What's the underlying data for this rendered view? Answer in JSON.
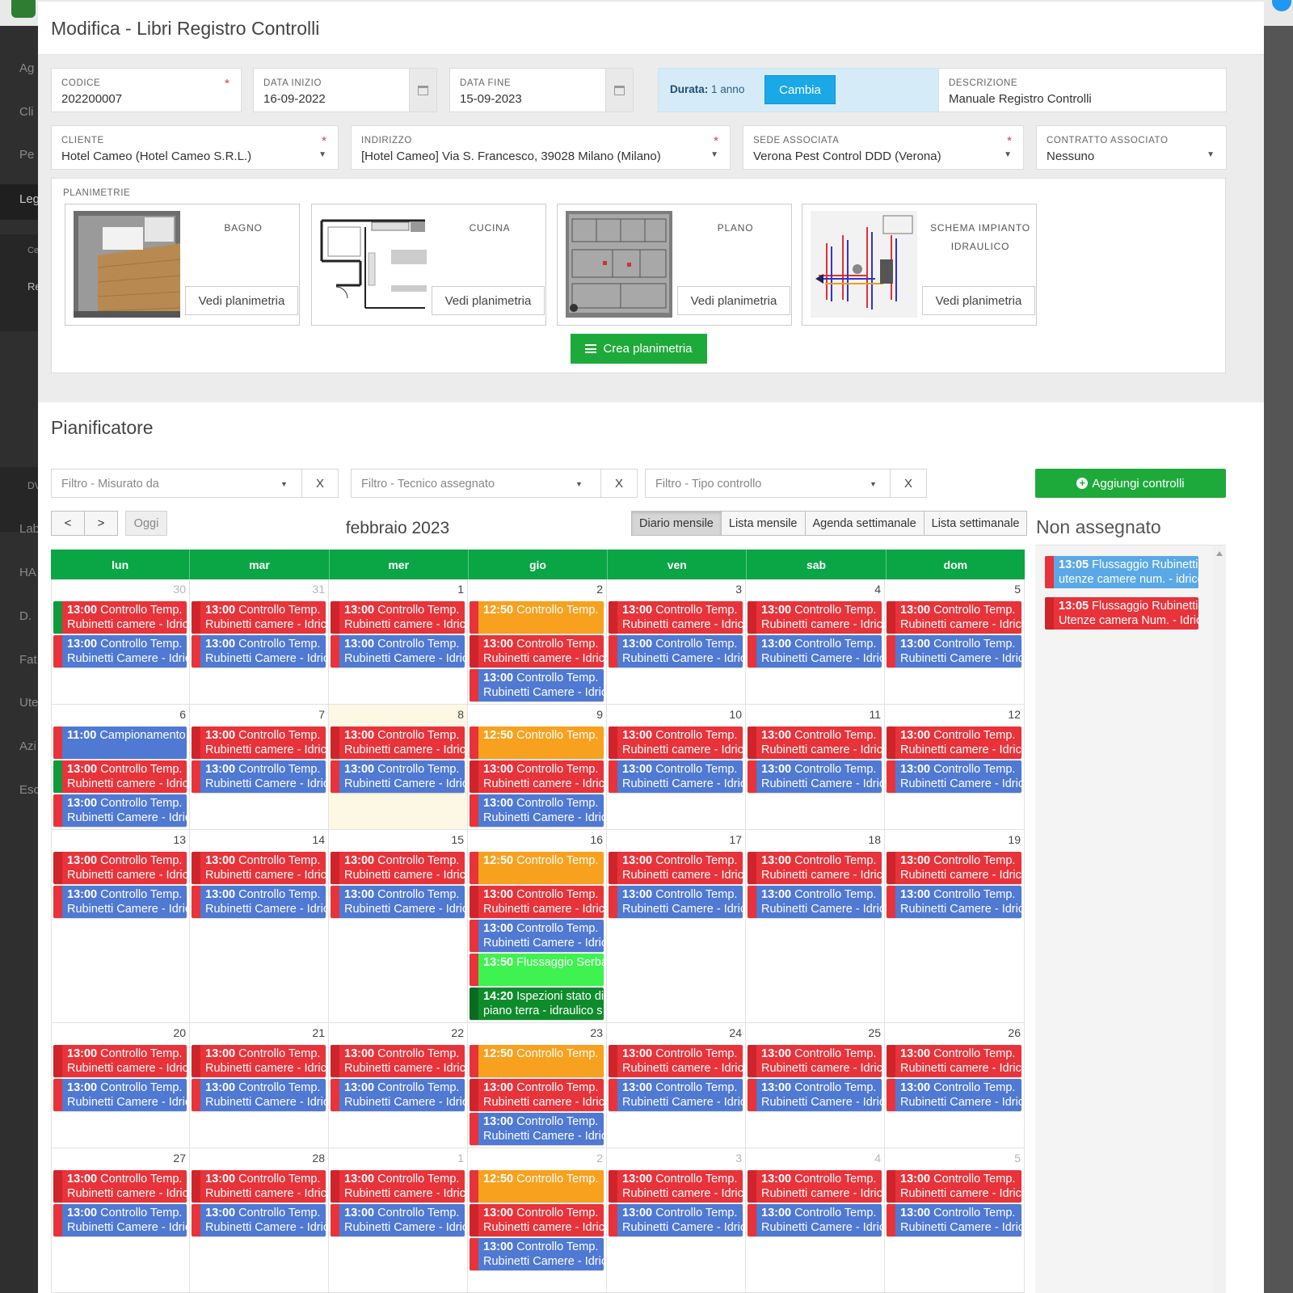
{
  "background": {
    "sidebar_items": [
      "Ag",
      "Cli",
      "Pe",
      "Leg",
      "Ce",
      "Re",
      "DV",
      "Lab",
      "HA",
      "D.",
      "Fat",
      "Ute",
      "Azi",
      "Esc"
    ]
  },
  "modal": {
    "title": "Modifica - Libri Registro Controlli",
    "fields": {
      "codice": {
        "label": "CODICE",
        "value": "202200007",
        "required": "*"
      },
      "data_inizio": {
        "label": "DATA INIZIO",
        "value": "16-09-2022"
      },
      "data_fine": {
        "label": "DATA FINE",
        "value": "15-09-2023"
      },
      "durata": {
        "label": "Durata:",
        "value": "1 anno",
        "button": "Cambia"
      },
      "descrizione": {
        "label": "DESCRIZIONE",
        "value": "Manuale Registro Controlli"
      },
      "cliente": {
        "label": "CLIENTE",
        "value": "Hotel Cameo (Hotel Cameo S.R.L.)",
        "required": "*"
      },
      "indirizzo": {
        "label": "INDIRIZZO",
        "value": "[Hotel Cameo] Via S. Francesco, 39028 Milano (Milano)",
        "required": "*"
      },
      "sede": {
        "label": "SEDE ASSOCIATA",
        "value": "Verona Pest Control DDD (Verona)",
        "required": "*"
      },
      "contratto": {
        "label": "CONTRATTO ASSOCIATO",
        "value": "Nessuno"
      }
    },
    "planimetrie": {
      "label": "PLANIMETRIE",
      "cards": [
        {
          "name": "BAGNO",
          "button": "Vedi planimetria"
        },
        {
          "name": "CUCINA",
          "button": "Vedi planimetria"
        },
        {
          "name": "PLANO",
          "button": "Vedi planimetria"
        },
        {
          "name": "SCHEMA IMPIANTO IDRAULICO",
          "button": "Vedi planimetria"
        }
      ],
      "create_button": "Crea planimetria"
    }
  },
  "pianificatore": {
    "title": "Pianificatore",
    "filters": [
      {
        "placeholder": "Filtro - Misurato da",
        "clear": "X"
      },
      {
        "placeholder": "Filtro - Tecnico assegnato",
        "clear": "X"
      },
      {
        "placeholder": "Filtro - Tipo controllo",
        "clear": "X"
      }
    ],
    "add_button": "Aggiungi controlli",
    "nav": {
      "prev": "<",
      "next": ">",
      "today": "Oggi"
    },
    "month_title": "febbraio 2023",
    "views": [
      "Diario mensile",
      "Lista mensile",
      "Agenda settimanale",
      "Lista settimanale"
    ],
    "active_view": "Diario mensile",
    "weekdays": [
      "lun",
      "mar",
      "mer",
      "gio",
      "ven",
      "sab",
      "dom"
    ],
    "weeks": [
      {
        "days": [
          "30",
          "31",
          "1",
          "2",
          "3",
          "4",
          "5"
        ],
        "other_month": [
          0,
          1
        ]
      },
      {
        "days": [
          "6",
          "7",
          "8",
          "9",
          "10",
          "11",
          "12"
        ],
        "today": 2
      },
      {
        "days": [
          "13",
          "14",
          "15",
          "16",
          "17",
          "18",
          "19"
        ]
      },
      {
        "days": [
          "20",
          "21",
          "22",
          "23",
          "24",
          "25",
          "26"
        ]
      },
      {
        "days": [
          "27",
          "28",
          "1",
          "2",
          "3",
          "4",
          "5"
        ],
        "other_month": [
          2,
          3,
          4,
          5,
          6
        ]
      }
    ],
    "event_texts": {
      "controllo_camere": {
        "time": "13:00",
        "title": "Controllo Temp.",
        "line2": "Rubinetti camere - Idrico"
      },
      "controllo_camere_cap": {
        "time": "13:00",
        "title": "Controllo Temp.",
        "line2": "Rubinetti Camere - Idrico"
      },
      "controllo_1250": {
        "time": "12:50",
        "title": "Controllo Temp.",
        "line2": ""
      },
      "campionamento": {
        "time": "11:00",
        "title": "Campionamento",
        "line2": ""
      },
      "flussaggio_serbatoi": {
        "time": "13:50",
        "title": "Flussaggio Serbatoi",
        "line2": ""
      },
      "ispezioni": {
        "time": "14:20",
        "title": "Ispezioni stato di",
        "line2": "piano terra - idraulico s"
      }
    },
    "colors": {
      "red": "#e8333a",
      "blue": "#4f79d3",
      "orange": "#f7a11e",
      "lime": "#3ef34f",
      "dark_green": "#0e8c2b",
      "header_green": "#0aa646"
    },
    "non_assegnato": {
      "title": "Non assegnato",
      "events": [
        {
          "time": "13:05",
          "title": "Flussaggio Rubinetti",
          "line2": "utenze camere num. - idrico",
          "color": "light-blue"
        },
        {
          "time": "13:05",
          "title": "Flussaggio Rubinetti",
          "line2": "Utenze camera Num. - Idrico",
          "color": "red"
        }
      ]
    }
  }
}
